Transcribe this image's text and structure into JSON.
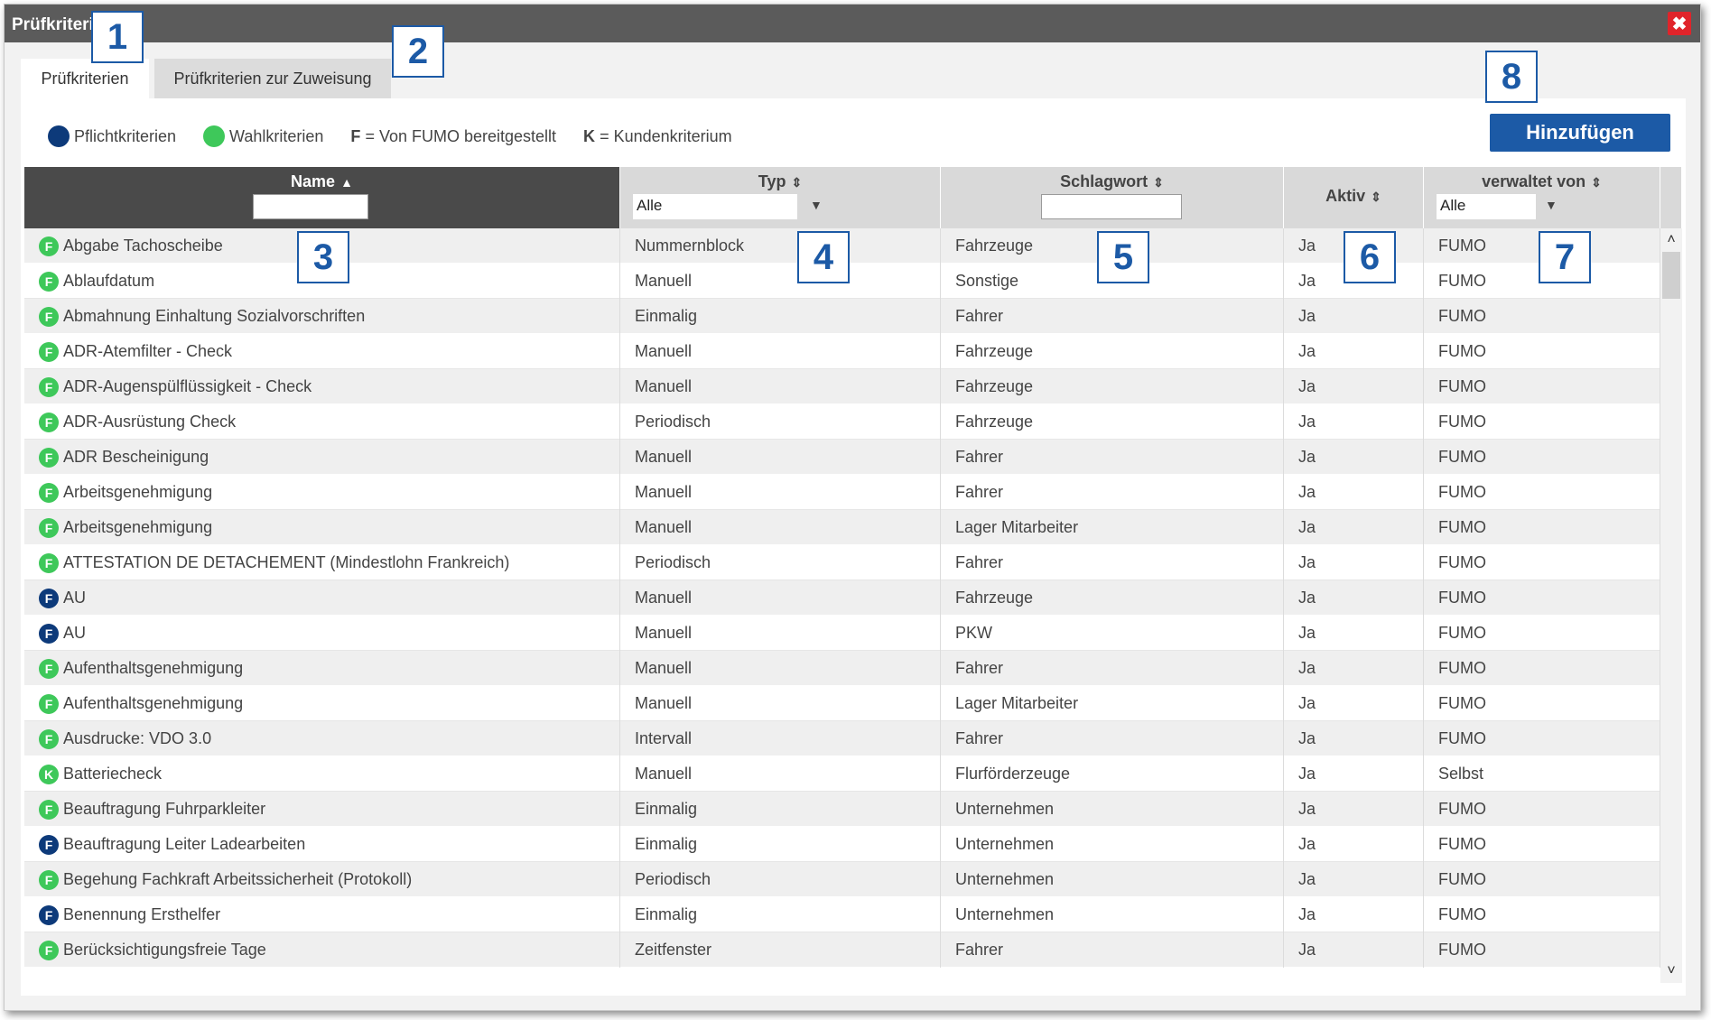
{
  "window": {
    "title": "Prüfkriterien",
    "close_label": "✖"
  },
  "tabs": [
    {
      "label": "Prüfkriterien",
      "active": true
    },
    {
      "label": "Prüfkriterien zur Zuweisung",
      "active": false
    }
  ],
  "legend": {
    "pflicht": {
      "label": "Pflichtkriterien",
      "color": "#0d3a7a"
    },
    "wahl": {
      "label": "Wahlkriterien",
      "color": "#3ec85a"
    },
    "f_key": "F",
    "f_text": "= Von FUMO bereitgestellt",
    "k_key": "K",
    "k_text": "= Kundenkriterium"
  },
  "add_button": {
    "label": "Hinzufügen"
  },
  "columns": {
    "name": {
      "label": "Name",
      "sort_icon": "▲",
      "filter_value": ""
    },
    "typ": {
      "label": "Typ",
      "sort_icon": "⇕",
      "filter_value": "Alle"
    },
    "schlagwort": {
      "label": "Schlagwort",
      "sort_icon": "⇕",
      "filter_value": ""
    },
    "aktiv": {
      "label": "Aktiv",
      "sort_icon": "⇕"
    },
    "verwaltet": {
      "label": "verwaltet von",
      "sort_icon": "⇕",
      "filter_value": "Alle"
    }
  },
  "rows": [
    {
      "badge": "F",
      "kind": "wahl",
      "name": "Abgabe Tachoscheibe",
      "typ": "Nummernblock",
      "schlagwort": "Fahrzeuge",
      "aktiv": "Ja",
      "verwaltet": "FUMO"
    },
    {
      "badge": "F",
      "kind": "wahl",
      "name": "Ablaufdatum",
      "typ": "Manuell",
      "schlagwort": "Sonstige",
      "aktiv": "Ja",
      "verwaltet": "FUMO"
    },
    {
      "badge": "F",
      "kind": "wahl",
      "name": "Abmahnung Einhaltung Sozialvorschriften",
      "typ": "Einmalig",
      "schlagwort": "Fahrer",
      "aktiv": "Ja",
      "verwaltet": "FUMO"
    },
    {
      "badge": "F",
      "kind": "wahl",
      "name": "ADR-Atemfilter - Check",
      "typ": "Manuell",
      "schlagwort": "Fahrzeuge",
      "aktiv": "Ja",
      "verwaltet": "FUMO"
    },
    {
      "badge": "F",
      "kind": "wahl",
      "name": "ADR-Augenspülflüssigkeit - Check",
      "typ": "Manuell",
      "schlagwort": "Fahrzeuge",
      "aktiv": "Ja",
      "verwaltet": "FUMO"
    },
    {
      "badge": "F",
      "kind": "wahl",
      "name": "ADR-Ausrüstung Check",
      "typ": "Periodisch",
      "schlagwort": "Fahrzeuge",
      "aktiv": "Ja",
      "verwaltet": "FUMO"
    },
    {
      "badge": "F",
      "kind": "wahl",
      "name": "ADR Bescheinigung",
      "typ": "Manuell",
      "schlagwort": "Fahrer",
      "aktiv": "Ja",
      "verwaltet": "FUMO"
    },
    {
      "badge": "F",
      "kind": "wahl",
      "name": "Arbeitsgenehmigung",
      "typ": "Manuell",
      "schlagwort": "Fahrer",
      "aktiv": "Ja",
      "verwaltet": "FUMO"
    },
    {
      "badge": "F",
      "kind": "wahl",
      "name": "Arbeitsgenehmigung",
      "typ": "Manuell",
      "schlagwort": "Lager Mitarbeiter",
      "aktiv": "Ja",
      "verwaltet": "FUMO"
    },
    {
      "badge": "F",
      "kind": "wahl",
      "name": "ATTESTATION DE DETACHEMENT (Mindestlohn Frankreich)",
      "typ": "Periodisch",
      "schlagwort": "Fahrer",
      "aktiv": "Ja",
      "verwaltet": "FUMO"
    },
    {
      "badge": "F",
      "kind": "pflicht",
      "name": "AU",
      "typ": "Manuell",
      "schlagwort": "Fahrzeuge",
      "aktiv": "Ja",
      "verwaltet": "FUMO"
    },
    {
      "badge": "F",
      "kind": "pflicht",
      "name": "AU",
      "typ": "Manuell",
      "schlagwort": "PKW",
      "aktiv": "Ja",
      "verwaltet": "FUMO"
    },
    {
      "badge": "F",
      "kind": "wahl",
      "name": "Aufenthaltsgenehmigung",
      "typ": "Manuell",
      "schlagwort": "Fahrer",
      "aktiv": "Ja",
      "verwaltet": "FUMO"
    },
    {
      "badge": "F",
      "kind": "wahl",
      "name": "Aufenthaltsgenehmigung",
      "typ": "Manuell",
      "schlagwort": "Lager Mitarbeiter",
      "aktiv": "Ja",
      "verwaltet": "FUMO"
    },
    {
      "badge": "F",
      "kind": "wahl",
      "name": "Ausdrucke: VDO 3.0",
      "typ": "Intervall",
      "schlagwort": "Fahrer",
      "aktiv": "Ja",
      "verwaltet": "FUMO"
    },
    {
      "badge": "K",
      "kind": "wahl",
      "name": "Batteriecheck",
      "typ": "Manuell",
      "schlagwort": "Flurförderzeuge",
      "aktiv": "Ja",
      "verwaltet": "Selbst"
    },
    {
      "badge": "F",
      "kind": "wahl",
      "name": "Beauftragung Fuhrparkleiter",
      "typ": "Einmalig",
      "schlagwort": "Unternehmen",
      "aktiv": "Ja",
      "verwaltet": "FUMO"
    },
    {
      "badge": "F",
      "kind": "pflicht",
      "name": "Beauftragung Leiter Ladearbeiten",
      "typ": "Einmalig",
      "schlagwort": "Unternehmen",
      "aktiv": "Ja",
      "verwaltet": "FUMO"
    },
    {
      "badge": "F",
      "kind": "wahl",
      "name": "Begehung Fachkraft Arbeitssicherheit (Protokoll)",
      "typ": "Periodisch",
      "schlagwort": "Unternehmen",
      "aktiv": "Ja",
      "verwaltet": "FUMO"
    },
    {
      "badge": "F",
      "kind": "pflicht",
      "name": "Benennung Ersthelfer",
      "typ": "Einmalig",
      "schlagwort": "Unternehmen",
      "aktiv": "Ja",
      "verwaltet": "FUMO"
    },
    {
      "badge": "F",
      "kind": "wahl",
      "name": "Berücksichtigungsfreie Tage",
      "typ": "Zeitfenster",
      "schlagwort": "Fahrer",
      "aktiv": "Ja",
      "verwaltet": "FUMO"
    }
  ],
  "scrollbar": {
    "up_icon": "˄",
    "down_icon": "˅"
  },
  "callouts": [
    "1",
    "2",
    "3",
    "4",
    "5",
    "6",
    "7",
    "8"
  ]
}
